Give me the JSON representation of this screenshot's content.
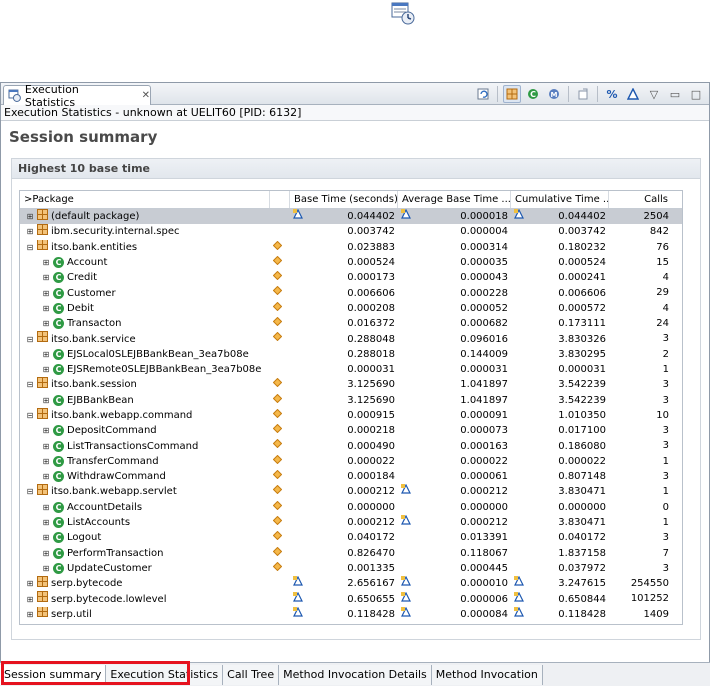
{
  "view": {
    "tab_label": "Execution Statistics",
    "info": "Execution Statistics - unknown at UELIT60 [PID: 6132]",
    "summary_title": "Session summary",
    "section_title": "Highest 10 base time"
  },
  "columns": {
    "package": ">Package",
    "base": "Base Time (seconds)",
    "avg": "Average Base Time ...",
    "cum": "Cumulative Time ...",
    "calls": "Calls"
  },
  "rows": [
    {
      "name": "(default package)",
      "type": "package",
      "expander": "+",
      "indent": 0,
      "mark_pkg": false,
      "mark_base": true,
      "base": "0.044402",
      "avg": "0.000018",
      "mark_avg": true,
      "cum": "0.044402",
      "mark_cum": true,
      "calls": "2504",
      "selected": true
    },
    {
      "name": "ibm.security.internal.spec",
      "type": "package",
      "expander": "+",
      "indent": 0,
      "mark_pkg": false,
      "mark_base": false,
      "base": "0.003742",
      "avg": "0.000004",
      "mark_avg": false,
      "cum": "0.003742",
      "mark_cum": false,
      "calls": "842"
    },
    {
      "name": "itso.bank.entities",
      "type": "package",
      "expander": "−",
      "indent": 0,
      "mark_pkg": true,
      "mark_base": false,
      "base": "0.023883",
      "avg": "0.000314",
      "mark_avg": false,
      "cum": "0.180232",
      "mark_cum": false,
      "calls": "76"
    },
    {
      "name": "Account",
      "type": "class",
      "expander": "+",
      "indent": 1,
      "mark_pkg": true,
      "mark_base": false,
      "base": "0.000524",
      "avg": "0.000035",
      "mark_avg": false,
      "cum": "0.000524",
      "mark_cum": false,
      "calls": "15"
    },
    {
      "name": "Credit",
      "type": "class",
      "expander": "+",
      "indent": 1,
      "mark_pkg": true,
      "mark_base": false,
      "base": "0.000173",
      "avg": "0.000043",
      "mark_avg": false,
      "cum": "0.000241",
      "mark_cum": false,
      "calls": "4"
    },
    {
      "name": "Customer",
      "type": "class",
      "expander": "+",
      "indent": 1,
      "mark_pkg": true,
      "mark_base": false,
      "base": "0.006606",
      "avg": "0.000228",
      "mark_avg": false,
      "cum": "0.006606",
      "mark_cum": false,
      "calls": "29"
    },
    {
      "name": "Debit",
      "type": "class",
      "expander": "+",
      "indent": 1,
      "mark_pkg": true,
      "mark_base": false,
      "base": "0.000208",
      "avg": "0.000052",
      "mark_avg": false,
      "cum": "0.000572",
      "mark_cum": false,
      "calls": "4"
    },
    {
      "name": "Transacton",
      "type": "class",
      "expander": "+",
      "indent": 1,
      "mark_pkg": true,
      "mark_base": false,
      "base": "0.016372",
      "avg": "0.000682",
      "mark_avg": false,
      "cum": "0.173111",
      "mark_cum": false,
      "calls": "24"
    },
    {
      "name": "itso.bank.service",
      "type": "package",
      "expander": "−",
      "indent": 0,
      "mark_pkg": true,
      "mark_base": false,
      "base": "0.288048",
      "avg": "0.096016",
      "mark_avg": false,
      "cum": "3.830326",
      "mark_cum": false,
      "calls": "3"
    },
    {
      "name": "EJSLocal0SLEJBBankBean_3ea7b08e",
      "type": "class",
      "expander": "+",
      "indent": 1,
      "mark_pkg": false,
      "mark_base": false,
      "base": "0.288018",
      "avg": "0.144009",
      "mark_avg": false,
      "cum": "3.830295",
      "mark_cum": false,
      "calls": "2"
    },
    {
      "name": "EJSRemote0SLEJBBankBean_3ea7b08e",
      "type": "class",
      "expander": "+",
      "indent": 1,
      "mark_pkg": false,
      "mark_base": false,
      "base": "0.000031",
      "avg": "0.000031",
      "mark_avg": false,
      "cum": "0.000031",
      "mark_cum": false,
      "calls": "1"
    },
    {
      "name": "itso.bank.session",
      "type": "package",
      "expander": "−",
      "indent": 0,
      "mark_pkg": true,
      "mark_base": false,
      "base": "3.125690",
      "avg": "1.041897",
      "mark_avg": false,
      "cum": "3.542239",
      "mark_cum": false,
      "calls": "3"
    },
    {
      "name": "EJBBankBean",
      "type": "class",
      "expander": "+",
      "indent": 1,
      "mark_pkg": true,
      "mark_base": false,
      "base": "3.125690",
      "avg": "1.041897",
      "mark_avg": false,
      "cum": "3.542239",
      "mark_cum": false,
      "calls": "3"
    },
    {
      "name": "itso.bank.webapp.command",
      "type": "package",
      "expander": "−",
      "indent": 0,
      "mark_pkg": true,
      "mark_base": false,
      "base": "0.000915",
      "avg": "0.000091",
      "mark_avg": false,
      "cum": "1.010350",
      "mark_cum": false,
      "calls": "10"
    },
    {
      "name": "DepositCommand",
      "type": "class",
      "expander": "+",
      "indent": 1,
      "mark_pkg": true,
      "mark_base": false,
      "base": "0.000218",
      "avg": "0.000073",
      "mark_avg": false,
      "cum": "0.017100",
      "mark_cum": false,
      "calls": "3"
    },
    {
      "name": "ListTransactionsCommand",
      "type": "class",
      "expander": "+",
      "indent": 1,
      "mark_pkg": true,
      "mark_base": false,
      "base": "0.000490",
      "avg": "0.000163",
      "mark_avg": false,
      "cum": "0.186080",
      "mark_cum": false,
      "calls": "3"
    },
    {
      "name": "TransferCommand",
      "type": "class",
      "expander": "+",
      "indent": 1,
      "mark_pkg": true,
      "mark_base": false,
      "base": "0.000022",
      "avg": "0.000022",
      "mark_avg": false,
      "cum": "0.000022",
      "mark_cum": false,
      "calls": "1"
    },
    {
      "name": "WithdrawCommand",
      "type": "class",
      "expander": "+",
      "indent": 1,
      "mark_pkg": true,
      "mark_base": false,
      "base": "0.000184",
      "avg": "0.000061",
      "mark_avg": false,
      "cum": "0.807148",
      "mark_cum": false,
      "calls": "3"
    },
    {
      "name": "itso.bank.webapp.servlet",
      "type": "package",
      "expander": "−",
      "indent": 0,
      "mark_pkg": true,
      "mark_base": false,
      "base": "0.000212",
      "avg": "0.000212",
      "mark_avg": true,
      "cum": "3.830471",
      "mark_cum": false,
      "calls": "1"
    },
    {
      "name": "AccountDetails",
      "type": "class",
      "expander": "+",
      "indent": 1,
      "mark_pkg": true,
      "mark_base": false,
      "base": "0.000000",
      "avg": "0.000000",
      "mark_avg": false,
      "cum": "0.000000",
      "mark_cum": false,
      "calls": "0"
    },
    {
      "name": "ListAccounts",
      "type": "class",
      "expander": "+",
      "indent": 1,
      "mark_pkg": true,
      "mark_base": false,
      "base": "0.000212",
      "avg": "0.000212",
      "mark_avg": true,
      "cum": "3.830471",
      "mark_cum": false,
      "calls": "1"
    },
    {
      "name": "Logout",
      "type": "class",
      "expander": "+",
      "indent": 1,
      "mark_pkg": true,
      "mark_base": false,
      "base": "0.040172",
      "avg": "0.013391",
      "mark_avg": false,
      "cum": "0.040172",
      "mark_cum": false,
      "calls": "3"
    },
    {
      "name": "PerformTransaction",
      "type": "class",
      "expander": "+",
      "indent": 1,
      "mark_pkg": true,
      "mark_base": false,
      "base": "0.826470",
      "avg": "0.118067",
      "mark_avg": false,
      "cum": "1.837158",
      "mark_cum": false,
      "calls": "7"
    },
    {
      "name": "UpdateCustomer",
      "type": "class",
      "expander": "+",
      "indent": 1,
      "mark_pkg": true,
      "mark_base": false,
      "base": "0.001335",
      "avg": "0.000445",
      "mark_avg": false,
      "cum": "0.037972",
      "mark_cum": false,
      "calls": "3"
    },
    {
      "name": "serp.bytecode",
      "type": "package",
      "expander": "+",
      "indent": 0,
      "mark_pkg": false,
      "mark_base": true,
      "base": "2.656167",
      "avg": "0.000010",
      "mark_avg": true,
      "cum": "3.247615",
      "mark_cum": true,
      "calls": "254550"
    },
    {
      "name": "serp.bytecode.lowlevel",
      "type": "package",
      "expander": "+",
      "indent": 0,
      "mark_pkg": false,
      "mark_base": true,
      "base": "0.650655",
      "avg": "0.000006",
      "mark_avg": true,
      "cum": "0.650844",
      "mark_cum": true,
      "calls": "101252"
    },
    {
      "name": "serp.util",
      "type": "package",
      "expander": "+",
      "indent": 0,
      "mark_pkg": false,
      "mark_base": true,
      "base": "0.118428",
      "avg": "0.000084",
      "mark_avg": true,
      "cum": "0.118428",
      "mark_cum": true,
      "calls": "1409"
    }
  ],
  "bottom_tabs": [
    {
      "label": "Session summary",
      "active": true
    },
    {
      "label": "Execution Statistics",
      "active": false
    },
    {
      "label": "Call Tree",
      "active": false
    },
    {
      "label": "Method Invocation Details",
      "active": false
    },
    {
      "label": "Method Invocation",
      "active": false
    }
  ],
  "colors": {
    "highlight_border": "#e5121e",
    "package_icon": "#c97b1c",
    "class_icon": "#2f9a44"
  }
}
